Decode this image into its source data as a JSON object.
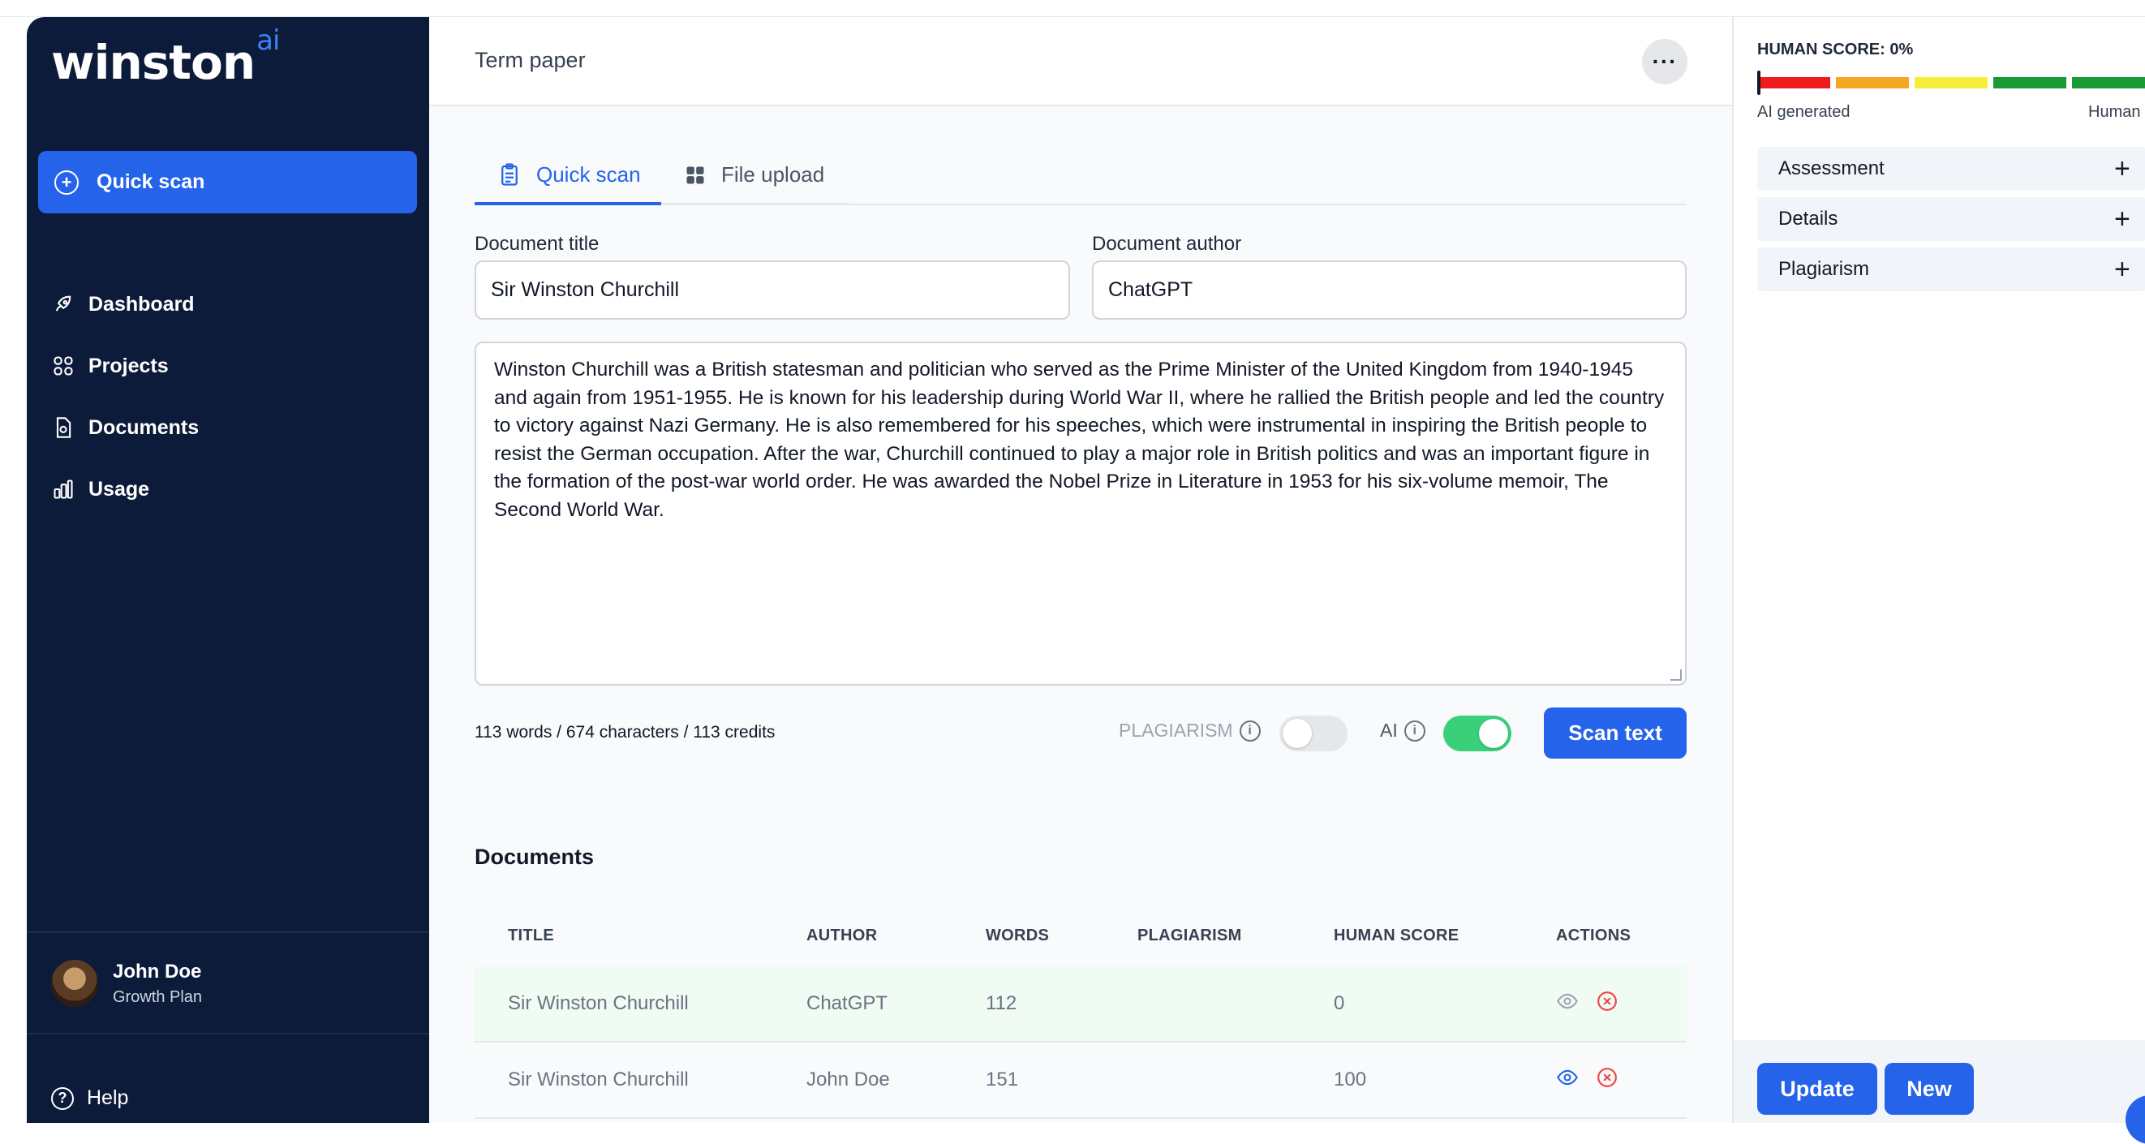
{
  "brand": {
    "name": "winston",
    "suffix": "ai"
  },
  "sidebar": {
    "quick_scan": "Quick scan",
    "items": [
      {
        "label": "Dashboard",
        "icon": "rocket-icon"
      },
      {
        "label": "Projects",
        "icon": "grid-icon"
      },
      {
        "label": "Documents",
        "icon": "document-icon"
      },
      {
        "label": "Usage",
        "icon": "bar-chart-icon"
      }
    ],
    "user": {
      "name": "John Doe",
      "plan": "Growth Plan"
    },
    "help": "Help"
  },
  "header": {
    "title": "Term paper",
    "more": "···"
  },
  "tabs": [
    {
      "label": "Quick scan",
      "active": true
    },
    {
      "label": "File upload",
      "active": false
    }
  ],
  "form": {
    "title_label": "Document title",
    "title_value": "Sir Winston Churchill",
    "author_label": "Document author",
    "author_value": "ChatGPT",
    "text": "Winston Churchill was a British statesman and politician who served as the Prime Minister of the United Kingdom from 1940-1945 and again from 1951-1955. He is known for his leadership during World War II, where he rallied the British people and led the country to victory against Nazi Germany. He is also remembered for his speeches, which were instrumental in inspiring the British people to resist the German occupation. After the war, Churchill continued to play a major role in British politics and was an important figure in the formation of the post-war world order. He was awarded the Nobel Prize in Literature in 1953 for his six-volume memoir, The Second World War.",
    "counts": "113 words / 674 characters / 113 credits",
    "plagiarism_label": "PLAGIARISM",
    "plagiarism_on": false,
    "ai_label": "AI",
    "ai_on": true,
    "scan_button": "Scan text"
  },
  "documents": {
    "title": "Documents",
    "columns": [
      "TITLE",
      "AUTHOR",
      "WORDS",
      "PLAGIARISM",
      "HUMAN SCORE",
      "ACTIONS"
    ],
    "rows": [
      {
        "title": "Sir Winston Churchill",
        "author": "ChatGPT",
        "words": "112",
        "plagiarism": "",
        "human_score": "0"
      },
      {
        "title": "Sir Winston Churchill",
        "author": "John Doe",
        "words": "151",
        "plagiarism": "",
        "human_score": "100"
      }
    ]
  },
  "right_panel": {
    "score_label": "HUMAN SCORE: 0%",
    "human_score": 0,
    "scale_left": "AI generated",
    "scale_right": "Human",
    "sections": [
      "Assessment",
      "Details",
      "Plagiarism"
    ],
    "update_button": "Update",
    "new_button": "New"
  },
  "colors": {
    "sidebar_bg": "#0d1b3a",
    "accent": "#2563eb",
    "toggle_on": "#3ad07a",
    "meter": [
      "#ef1c1c",
      "#f5a623",
      "#f5ef3a",
      "#1a9a35",
      "#1a9a35"
    ]
  }
}
